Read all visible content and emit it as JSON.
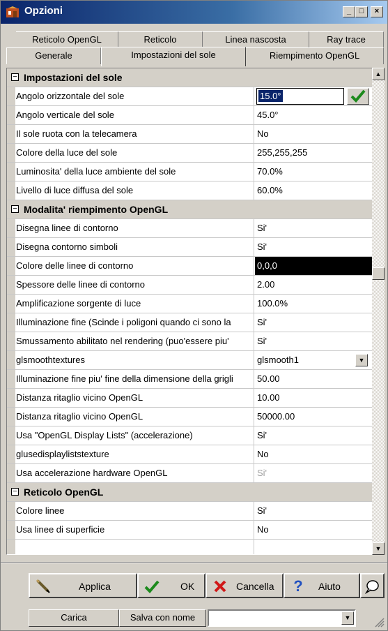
{
  "window": {
    "title": "Opzioni",
    "minimize": "_",
    "maximize": "□",
    "close": "×"
  },
  "tabs_top": [
    "Reticolo OpenGL",
    "Reticolo",
    "Linea nascosta",
    "Ray trace"
  ],
  "tabs_bottom": [
    "Generale",
    "Impostazioni del sole",
    "Riempimento OpenGL"
  ],
  "sections": [
    {
      "title": "Impostazioni del sole",
      "toggle": "−"
    },
    {
      "title": "Modalita' riempimento OpenGL",
      "toggle": "−"
    },
    {
      "title": "Reticolo OpenGL",
      "toggle": "−"
    }
  ],
  "props": [
    {
      "name": "Angolo orizzontale del sole",
      "value": "15.0°"
    },
    {
      "name": "Angolo verticale del sole",
      "value": "45.0°"
    },
    {
      "name": "Il sole ruota con la telecamera",
      "value": "No"
    },
    {
      "name": "Colore della luce del sole",
      "value": "255,255,255"
    },
    {
      "name": "Luminosita' della luce ambiente del sole",
      "value": "70.0%"
    },
    {
      "name": "Livello di luce diffusa del sole",
      "value": "60.0%"
    },
    {
      "name": "Disegna linee di contorno",
      "value": "Si'"
    },
    {
      "name": "Disegna contorno simboli",
      "value": "Si'"
    },
    {
      "name": "Colore delle linee di contorno",
      "value": "0,0,0"
    },
    {
      "name": "Spessore delle linee di contorno",
      "value": "2.00"
    },
    {
      "name": "Amplificazione sorgente di luce",
      "value": "100.0%"
    },
    {
      "name": "Illuminazione fine (Scinde i poligoni quando ci sono la",
      "value": "Si'"
    },
    {
      "name": "Smussamento abilitato nel rendering (puo'essere piu'",
      "value": "Si'"
    },
    {
      "name": "glsmoothtextures",
      "value": "glsmooth1"
    },
    {
      "name": "Illuminazione fine piu' fine della dimensione della grigli",
      "value": "50.00"
    },
    {
      "name": "Distanza ritaglio vicino OpenGL",
      "value": "10.00"
    },
    {
      "name": "Distanza ritaglio vicino OpenGL",
      "value": "50000.00"
    },
    {
      "name": "Usa \"OpenGL Display Lists\" (accelerazione)",
      "value": "Si'"
    },
    {
      "name": "glusedisplayliststexture",
      "value": "No"
    },
    {
      "name": "Usa accelerazione hardware OpenGL",
      "value": "Si'"
    },
    {
      "name": "Colore linee",
      "value": "Si'"
    },
    {
      "name": "Usa linee di superficie",
      "value": "No"
    }
  ],
  "buttons": {
    "apply": "Applica",
    "ok": "OK",
    "cancel": "Cancella",
    "help": "Aiuto",
    "load": "Carica",
    "save_as": "Salva con nome"
  },
  "combo_value": "",
  "colors": {
    "title_start": "#0a246a",
    "title_end": "#a6caf0",
    "selection": "#0a246a",
    "face": "#d4d0c8"
  }
}
